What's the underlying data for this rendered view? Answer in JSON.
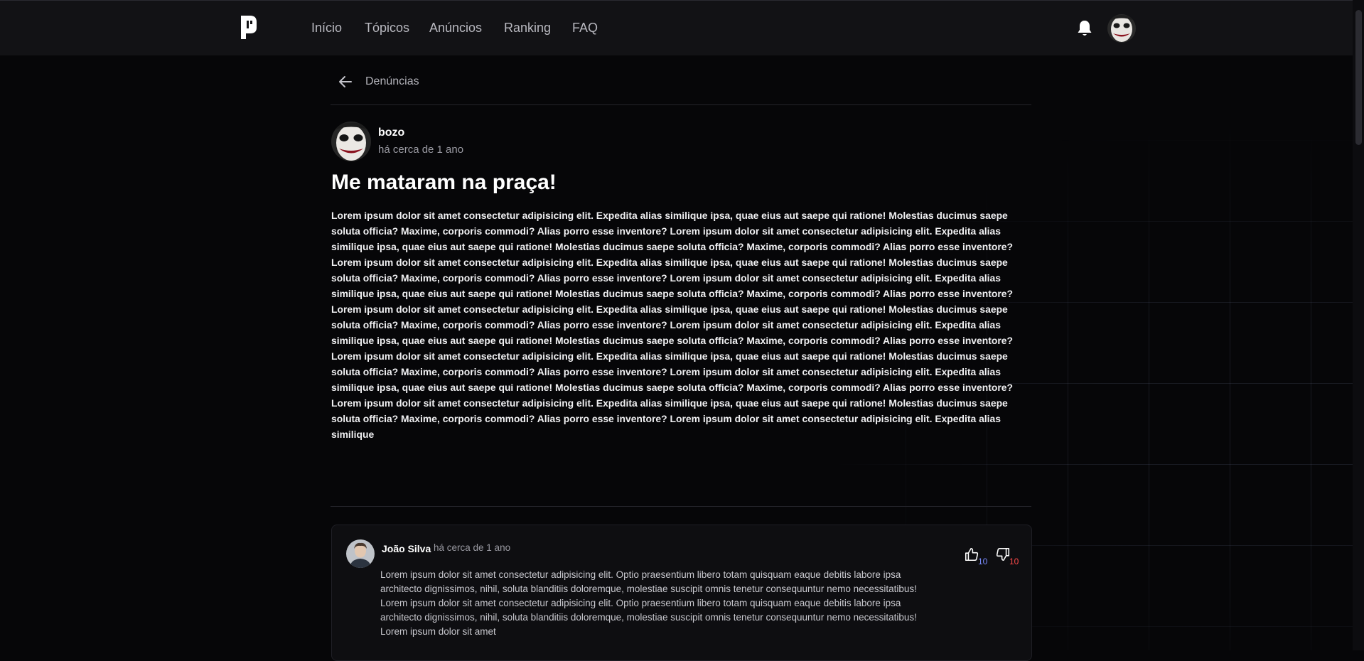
{
  "nav": {
    "items": [
      {
        "label": "Início"
      },
      {
        "label": "Tópicos"
      },
      {
        "label": "Anúncios"
      },
      {
        "label": "Ranking"
      },
      {
        "label": "FAQ"
      }
    ],
    "icons": {
      "logo": "logo-p-icon",
      "notifications": "bell-icon",
      "avatar": "joker-avatar"
    }
  },
  "breadcrumb": {
    "back_label": "Denúncias",
    "icon": "arrow-left-icon"
  },
  "post": {
    "author": "bozo",
    "time": "há cerca de 1 ano",
    "title": "Me mataram na praça!",
    "body": "Lorem ipsum dolor sit amet consectetur adipisicing elit. Expedita alias similique ipsa, quae eius aut saepe qui ratione! Molestias ducimus saepe soluta officia? Maxime, corporis commodi? Alias porro esse inventore? Lorem ipsum dolor sit amet consectetur adipisicing elit. Expedita alias similique ipsa, quae eius aut saepe qui ratione! Molestias ducimus saepe soluta officia? Maxime, corporis commodi? Alias porro esse inventore? Lorem ipsum dolor sit amet consectetur adipisicing elit. Expedita alias similique ipsa, quae eius aut saepe qui ratione! Molestias ducimus saepe soluta officia? Maxime, corporis commodi? Alias porro esse inventore? Lorem ipsum dolor sit amet consectetur adipisicing elit. Expedita alias similique ipsa, quae eius aut saepe qui ratione! Molestias ducimus saepe soluta officia? Maxime, corporis commodi? Alias porro esse inventore? Lorem ipsum dolor sit amet consectetur adipisicing elit. Expedita alias similique ipsa, quae eius aut saepe qui ratione! Molestias ducimus saepe soluta officia? Maxime, corporis commodi? Alias porro esse inventore? Lorem ipsum dolor sit amet consectetur adipisicing elit. Expedita alias similique ipsa, quae eius aut saepe qui ratione! Molestias ducimus saepe soluta officia? Maxime, corporis commodi? Alias porro esse inventore? Lorem ipsum dolor sit amet consectetur adipisicing elit. Expedita alias similique ipsa, quae eius aut saepe qui ratione! Molestias ducimus saepe soluta officia? Maxime, corporis commodi? Alias porro esse inventore? Lorem ipsum dolor sit amet consectetur adipisicing elit. Expedita alias similique ipsa, quae eius aut saepe qui ratione! Molestias ducimus saepe soluta officia? Maxime, corporis commodi? Alias porro esse inventore? Lorem ipsum dolor sit amet consectetur adipisicing elit. Expedita alias similique ipsa, quae eius aut saepe qui ratione! Molestias ducimus saepe soluta officia? Maxime, corporis commodi? Alias porro esse inventore? Lorem ipsum dolor sit amet consectetur adipisicing elit. Expedita alias similique"
  },
  "comments": [
    {
      "author": "João Silva",
      "time": "há cerca de 1 ano",
      "body": "Lorem ipsum dolor sit amet consectetur adipisicing elit. Optio praesentium libero totam quisquam eaque debitis labore ipsa architecto dignissimos, nihil, soluta blanditiis doloremque, molestiae suscipit omnis tenetur consequuntur nemo necessitatibus! Lorem ipsum dolor sit amet consectetur adipisicing elit. Optio praesentium libero totam quisquam eaque debitis labore ipsa architecto dignissimos, nihil, soluta blanditiis doloremque, molestiae suscipit omnis tenetur consequuntur nemo necessitatibus! Lorem ipsum dolor sit amet",
      "likes": "10",
      "dislikes": "10",
      "icons": {
        "like": "thumbs-up-icon",
        "dislike": "thumbs-down-icon"
      }
    }
  ],
  "colors": {
    "background": "#060608",
    "topbar": "#121215",
    "like": "#7a8cff",
    "dislike": "#ff4a4a"
  }
}
